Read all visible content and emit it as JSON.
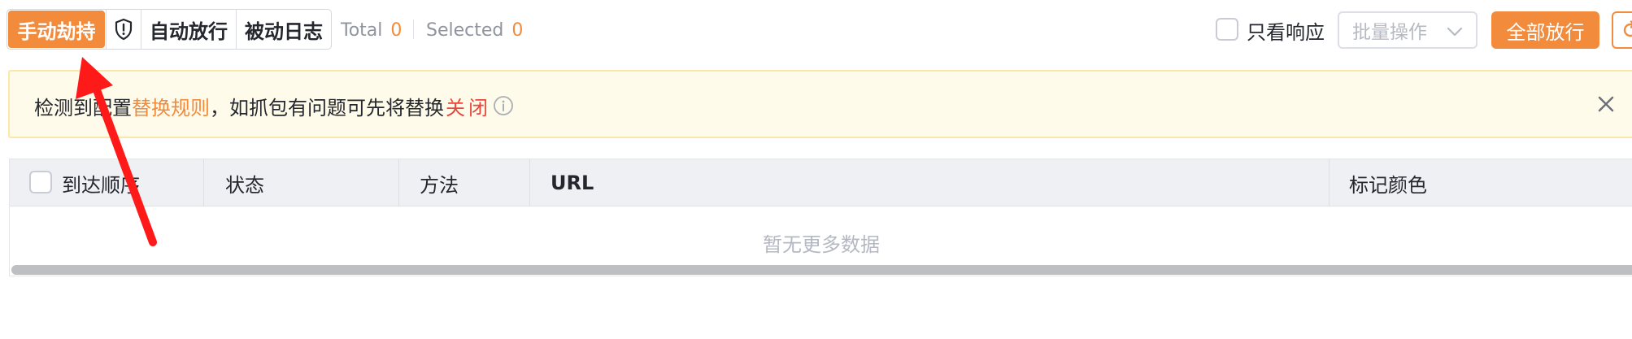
{
  "toolbar": {
    "mode_tabs": [
      {
        "label": "手动劫持",
        "active": true
      },
      {
        "label": "自动放行",
        "active": false
      },
      {
        "label": "被动日志",
        "active": false
      }
    ],
    "mode_icon": "shield-icon",
    "total_label": "Total",
    "total_value": "0",
    "selected_label": "Selected",
    "selected_value": "0",
    "only_response_label": "只看响应",
    "only_response_checked": false,
    "batch_select_placeholder": "批量操作",
    "release_all_label": "全部放行",
    "refresh_icon": "refresh-icon"
  },
  "alert": {
    "text_before": "检测到配置",
    "link_text": "替换规则",
    "text_after": "，如抓包有问题可先将替换",
    "close_word": "关闭",
    "info_icon": "info-icon",
    "dismiss_icon": "close-icon"
  },
  "table": {
    "columns": [
      "到达顺序",
      "状态",
      "方法",
      "URL",
      "标记颜色"
    ],
    "empty_text": "暂无更多数据"
  },
  "colors": {
    "accent": "#f28b3c",
    "alert_bg": "#fffbea",
    "alert_border": "#fbe7a8",
    "close_word": "#e8463b",
    "annotation": "#ff1a1a"
  },
  "annotation": {
    "icon": "red-arrow-annotation",
    "points_to": "手动劫持"
  }
}
